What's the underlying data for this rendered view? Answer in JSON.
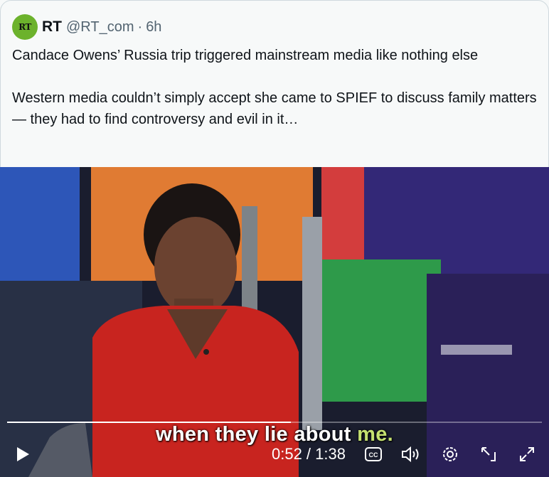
{
  "tweet": {
    "avatar_text": "RT",
    "name": "RT",
    "handle": "@RT_com",
    "separator": "·",
    "time": "6h",
    "paragraph1": "Candace Owens’ Russia trip triggered mainstream media like nothing else",
    "paragraph2": "Western media couldn’t simply accept she came to SPIEF to discuss family matters — they had to find controversy and evil in it…"
  },
  "video": {
    "caption_main": "when they lie about ",
    "caption_highlight": "me.",
    "current_time": "0:52",
    "duration": "1:38",
    "time_display": "0:52 / 1:38",
    "progress": 0.53
  },
  "icons": [
    "play-icon",
    "captions-icon",
    "volume-icon",
    "settings-icon",
    "pop-out-icon",
    "fullscreen-icon"
  ],
  "colors": {
    "avatar_bg": "#6cb22c",
    "caption_highlight": "#c4e070",
    "text": "#0f1419",
    "muted": "#536471"
  }
}
